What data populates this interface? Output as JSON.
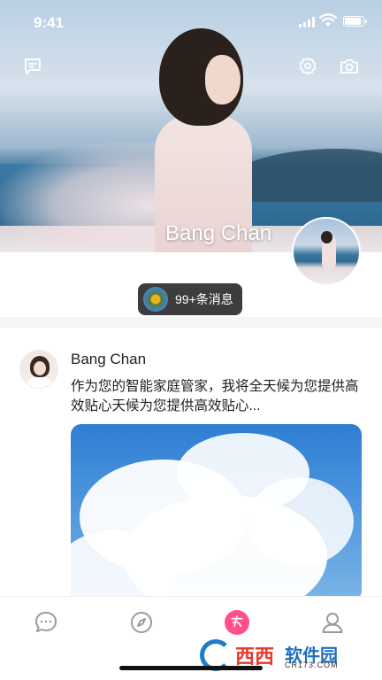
{
  "status_bar": {
    "time": "9:41"
  },
  "header": {
    "icons": [
      "message-icon",
      "settings-gear-icon",
      "camera-icon"
    ],
    "profile_name": "Bang Chan"
  },
  "notification": {
    "label": "99+条消息"
  },
  "post": {
    "author": "Bang Chan",
    "text": "作为您的智能家庭管家，我将全天候为您提供高效贴心天候为您提供高效贴心..."
  },
  "tabbar": {
    "items": [
      {
        "icon": "chat-bubble-icon",
        "active": false
      },
      {
        "icon": "compass-icon",
        "active": false
      },
      {
        "icon": "moments-icon",
        "active": true
      },
      {
        "icon": "profile-icon",
        "active": false
      }
    ],
    "accent": "#ff4f8e"
  },
  "watermark": {
    "title_red": "西西",
    "title_blue": "软件园",
    "site": "CR173.COM"
  }
}
